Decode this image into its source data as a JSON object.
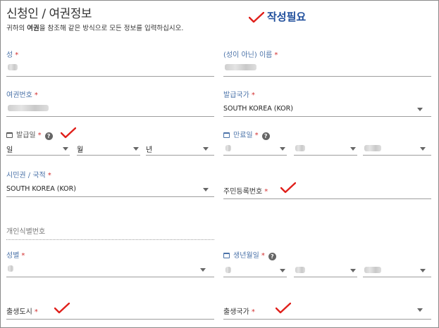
{
  "header": {
    "title": "신청인 / 여권정보",
    "subtitle_prefix": "귀하의 ",
    "subtitle_bold": "여권",
    "subtitle_suffix": "을 참조해 같은 방식으로 모든 정보를 입력하십시오.",
    "annotation": "작성필요"
  },
  "fields": {
    "surname": {
      "label": "성",
      "required": "*"
    },
    "given_name": {
      "label": "(성이 아닌) 이름",
      "required": "*"
    },
    "passport_number": {
      "label": "여권번호",
      "required": "*"
    },
    "issuing_country": {
      "label": "발급국가",
      "required": "*",
      "value": "SOUTH KOREA (KOR)"
    },
    "issue_date": {
      "label": "발급일",
      "required": "*",
      "day": "일",
      "month": "월",
      "year": "년"
    },
    "expiry_date": {
      "label": "만료일",
      "required": "*"
    },
    "citizenship": {
      "label": "시민권 / 국적",
      "required": "*",
      "value": "SOUTH KOREA (KOR)"
    },
    "resident_number": {
      "label": "주민등록번호",
      "required": "*"
    },
    "personal_id": {
      "placeholder": "개인식별번호"
    },
    "gender": {
      "label": "성별",
      "required": "*"
    },
    "birth_date": {
      "label": "생년월일",
      "required": "*"
    },
    "birth_city": {
      "label": "출생도시",
      "required": "*"
    },
    "birth_country": {
      "label": "출생국가",
      "required": "*"
    }
  },
  "colors": {
    "label_blue": "#4a72a8",
    "required_red": "#d32f2f",
    "annotation_blue": "#1f4e9c",
    "check_red": "#e0201b"
  },
  "icons": {
    "calendar": "calendar-icon",
    "help": "help-icon",
    "dropdown": "chevron-down-icon",
    "check": "check-mark-icon"
  }
}
